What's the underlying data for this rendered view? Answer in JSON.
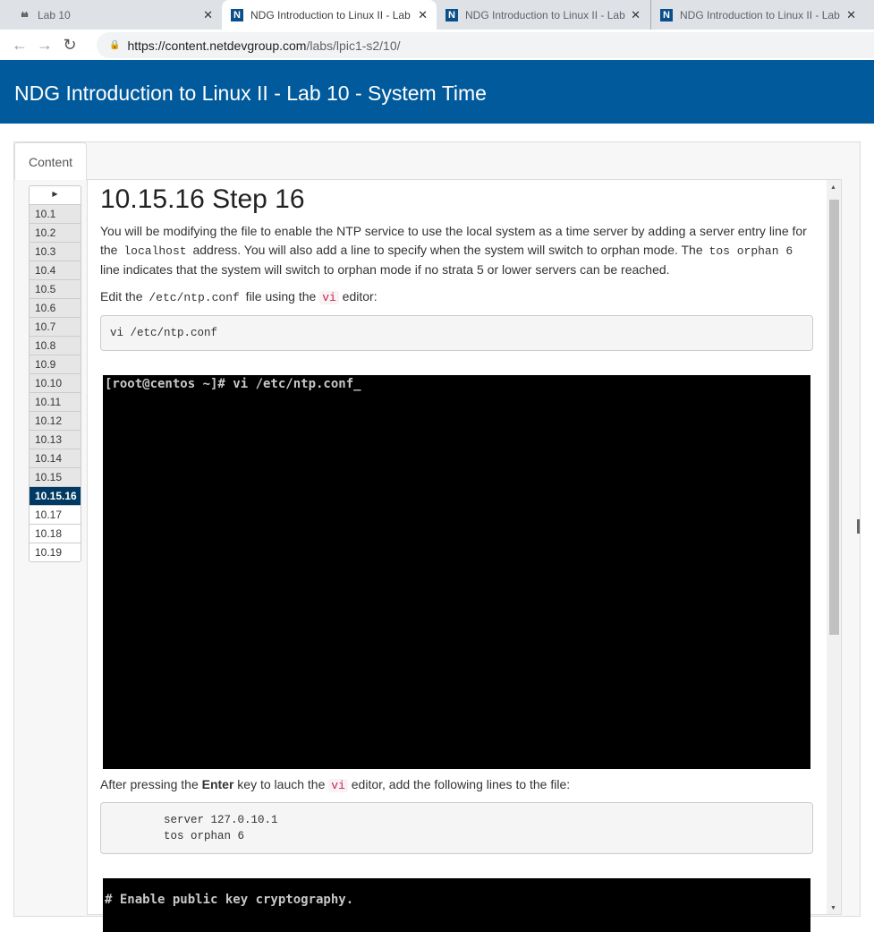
{
  "browser": {
    "tabs": [
      {
        "title": "Lab 10",
        "icon": "cisco-icon"
      },
      {
        "title": "NDG Introduction to Linux II - Lab",
        "icon": "ndg-icon",
        "active": true
      },
      {
        "title": "NDG Introduction to Linux II - Lab",
        "icon": "ndg-icon"
      },
      {
        "title": "NDG Introduction to Linux II - Lab",
        "icon": "ndg-icon"
      }
    ],
    "url_host": "https://content.netdevgroup.com",
    "url_path": "/labs/lpic1-s2/10/"
  },
  "header": {
    "title": "NDG Introduction to Linux II - Lab 10 - System Time",
    "color": "#005a9c"
  },
  "content_tab": "Content",
  "sidebar": {
    "items": [
      "10.1",
      "10.2",
      "10.3",
      "10.4",
      "10.5",
      "10.6",
      "10.7",
      "10.8",
      "10.9",
      "10.10",
      "10.11",
      "10.12",
      "10.13",
      "10.14",
      "10.15",
      "10.15.16",
      "10.17",
      "10.18",
      "10.19"
    ],
    "current": "10.15.16"
  },
  "main": {
    "heading": "10.15.16 Step 16",
    "p1": {
      "a": "You will be modifying the file to enable the NTP service to use the local system as a time server by adding a server entry line for the ",
      "c1": "localhost",
      "b": " address. You will also add a line to specify when the system will switch to orphan mode. The ",
      "c2": "tos orphan 6",
      "c": " line indicates that the system will switch to orphan mode if no strata 5 or lower servers can be reached."
    },
    "p2": {
      "a": "Edit the ",
      "c1": "/etc/ntp.conf",
      "b": " file using the ",
      "c2": "vi",
      "c": " editor:"
    },
    "code1": "vi /etc/ntp.conf",
    "term1": "[root@centos ~]# vi /etc/ntp.conf_",
    "p3": {
      "a": "After pressing the ",
      "bold": "Enter",
      "b": " key to lauch the ",
      "c1": "vi",
      "c": " editor, add the following lines to the file:"
    },
    "code2": "        server 127.0.10.1\n        tos orphan 6",
    "term2": "# Enable public key cryptography."
  }
}
